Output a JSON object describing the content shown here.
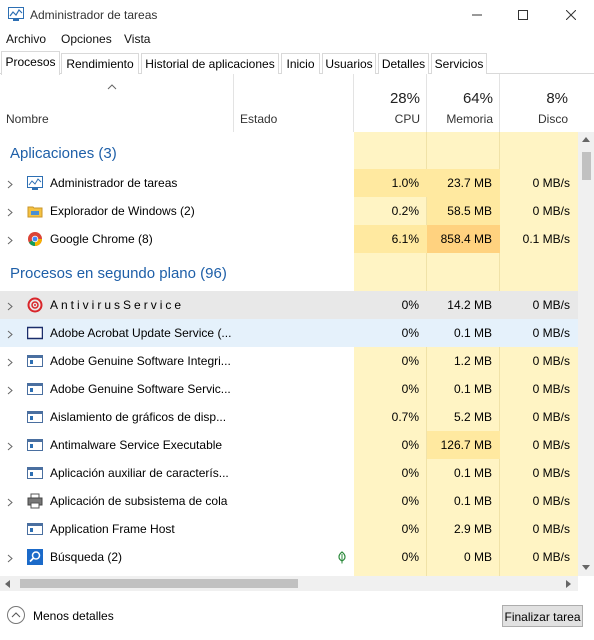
{
  "window": {
    "title": "Administrador de tareas",
    "icon": "task-manager-icon"
  },
  "menu": [
    "Archivo",
    "Opciones",
    "Vista"
  ],
  "tabs": [
    "Procesos",
    "Rendimiento",
    "Historial de aplicaciones",
    "Inicio",
    "Usuarios",
    "Detalles",
    "Servicios"
  ],
  "active_tab": "Procesos",
  "columns": {
    "name": "Nombre",
    "status": "Estado",
    "cpu": {
      "pct": "28%",
      "label": "CPU"
    },
    "memory": {
      "pct": "64%",
      "label": "Memoria"
    },
    "disk": {
      "pct": "8%",
      "label": "Disco"
    }
  },
  "groups": {
    "apps": "Aplicaciones (3)",
    "background": "Procesos en segundo plano (96)"
  },
  "apps": [
    {
      "name": "Administrador de tareas",
      "icon": "task-manager-icon",
      "cpu": "1.0%",
      "mem": "23.7 MB",
      "disk": "0 MB/s"
    },
    {
      "name": "Explorador de Windows (2)",
      "icon": "folder-icon",
      "cpu": "0.2%",
      "mem": "58.5 MB",
      "disk": "0 MB/s"
    },
    {
      "name": "Google Chrome (8)",
      "icon": "chrome-icon",
      "cpu": "6.1%",
      "mem": "858.4 MB",
      "disk": "0.1 MB/s"
    }
  ],
  "background": [
    {
      "name": "AntivirusService",
      "icon": "antivirus-icon",
      "cpu": "0%",
      "mem": "14.2 MB",
      "disk": "0 MB/s"
    },
    {
      "name": "Adobe Acrobat Update Service (...",
      "icon": "window-icon",
      "cpu": "0%",
      "mem": "0.1 MB",
      "disk": "0 MB/s"
    },
    {
      "name": "Adobe Genuine Software Integri...",
      "icon": "service-icon",
      "cpu": "0%",
      "mem": "1.2 MB",
      "disk": "0 MB/s"
    },
    {
      "name": "Adobe Genuine Software Servic...",
      "icon": "service-icon",
      "cpu": "0%",
      "mem": "0.1 MB",
      "disk": "0 MB/s"
    },
    {
      "name": "Aislamiento de gráficos de disp...",
      "icon": "service-icon",
      "cpu": "0.7%",
      "mem": "5.2 MB",
      "disk": "0 MB/s"
    },
    {
      "name": "Antimalware Service Executable",
      "icon": "service-icon",
      "cpu": "0%",
      "mem": "126.7 MB",
      "disk": "0 MB/s"
    },
    {
      "name": "Aplicación auxiliar de caracterís...",
      "icon": "service-icon",
      "cpu": "0%",
      "mem": "0.1 MB",
      "disk": "0 MB/s"
    },
    {
      "name": "Aplicación de subsistema de cola",
      "icon": "printer-icon",
      "cpu": "0%",
      "mem": "0.1 MB",
      "disk": "0 MB/s"
    },
    {
      "name": "Application Frame Host",
      "icon": "service-icon",
      "cpu": "0%",
      "mem": "2.9 MB",
      "disk": "0 MB/s"
    },
    {
      "name": "Búsqueda (2)",
      "icon": "search-icon",
      "cpu": "0%",
      "mem": "0 MB",
      "disk": "0 MB/s"
    }
  ],
  "footer": {
    "less_details": "Menos detalles",
    "end_task": "Finalizar tarea"
  },
  "colors": {
    "heat_light": "#fff4c4",
    "heat_mid": "#ffe9a0",
    "heat_strong": "#ffd27f",
    "group_title": "#1e5fa8"
  }
}
